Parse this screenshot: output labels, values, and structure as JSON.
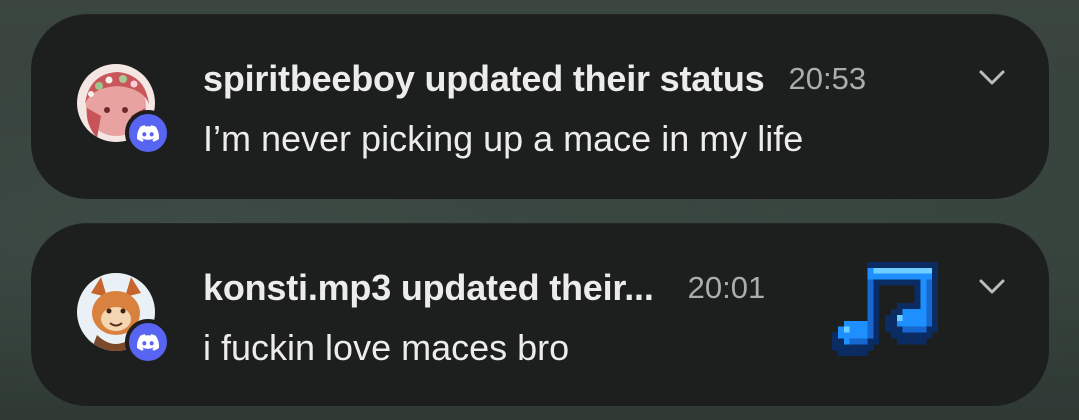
{
  "notifications": [
    {
      "title": "spiritbeeboy updated their status",
      "time": "20:53",
      "message": "I’m never picking up a mace in my life",
      "avatar_icon": "user-avatar-pink-hair",
      "badge_icon": "discord-icon"
    },
    {
      "title": "konsti.mp3 updated their...",
      "time": "20:01",
      "message": "i fuckin love maces bro",
      "avatar_icon": "user-avatar-fox",
      "badge_icon": "discord-icon",
      "attachment_icon": "music-note-icon"
    }
  ],
  "colors": {
    "discord_blurple": "#5865f2",
    "card_background": "#1c1f1e",
    "music_note_blue": "#1e90ff"
  }
}
